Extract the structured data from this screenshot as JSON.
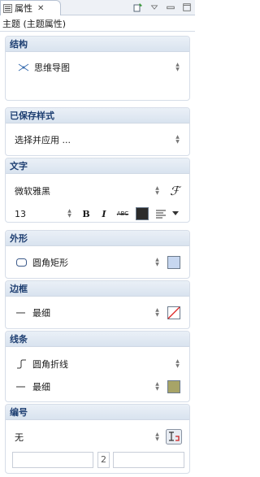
{
  "tab": {
    "label": "属性",
    "close": "✕"
  },
  "subtitle": "主题 (主题属性)",
  "sections": {
    "structure": {
      "title": "结构",
      "value": "思维导图"
    },
    "saved_style": {
      "title": "已保存样式",
      "value": "选择并应用 ..."
    },
    "text": {
      "title": "文字",
      "font": "微软雅黑",
      "size": "13",
      "bold": "B",
      "italic": "I",
      "strike": "ABC",
      "font_button": "ℱ"
    },
    "shape": {
      "title": "外形",
      "value": "圆角矩形",
      "color": "#c7d7f0"
    },
    "border": {
      "title": "边框",
      "value": "最细"
    },
    "line": {
      "title": "线条",
      "value1": "圆角折线",
      "value2": "最细",
      "color": "#a7a467"
    },
    "numbering": {
      "title": "编号",
      "value": "无",
      "middle": "2"
    }
  },
  "colors": {
    "text_color": "#333333",
    "header_text": "#1e3f72"
  }
}
